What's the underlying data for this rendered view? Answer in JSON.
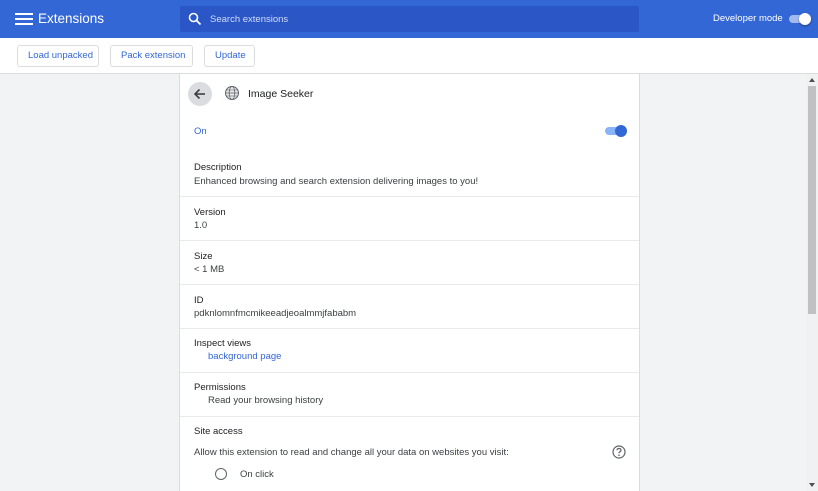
{
  "header": {
    "title": "Extensions",
    "menu_icon": "hamburger-menu-icon",
    "search": {
      "placeholder": "Search extensions",
      "value": "",
      "icon": "search-icon"
    },
    "developer_mode": {
      "label": "Developer mode",
      "enabled": true
    }
  },
  "toolbar": {
    "load_unpacked": "Load unpacked",
    "pack_extension": "Pack extension",
    "update": "Update"
  },
  "details": {
    "back_icon": "arrow-back-icon",
    "extension_icon": "puzzle-globe-icon",
    "name": "Image Seeker",
    "status_label": "On",
    "enabled": true,
    "description": {
      "label": "Description",
      "value": "Enhanced browsing and search extension delivering images to you!"
    },
    "version": {
      "label": "Version",
      "value": "1.0"
    },
    "size": {
      "label": "Size",
      "value": "< 1 MB"
    },
    "id": {
      "label": "ID",
      "value": "pdknlomnfmcmikeeadjeoalmmjfababm"
    },
    "inspect_views": {
      "label": "Inspect views",
      "links": [
        "background page"
      ]
    },
    "permissions": {
      "label": "Permissions",
      "items": [
        "Read your browsing history"
      ]
    },
    "site_access": {
      "label": "Site access",
      "prompt": "Allow this extension to read and change all your data on websites you visit:",
      "help_icon": "help-circle-icon",
      "options": [
        "On click"
      ]
    }
  },
  "colors": {
    "header": "#3367d6",
    "accent": "#3367d6",
    "background": "#f1f3f4"
  }
}
